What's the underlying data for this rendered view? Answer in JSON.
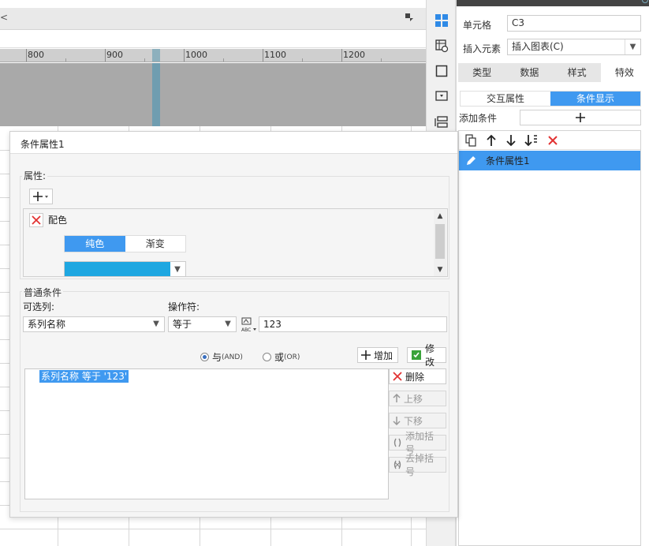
{
  "ruler": {
    "labels": [
      "800",
      "900",
      "1000",
      "1100",
      "1200"
    ]
  },
  "right_panel": {
    "cell_label": "单元格",
    "cell_value": "C3",
    "insert_label": "插入元素",
    "insert_value": "插入图表(C)",
    "tabs": [
      "类型",
      "数据",
      "样式",
      "特效"
    ],
    "active_tab": "特效",
    "subtabs": [
      "交互属性",
      "条件显示"
    ],
    "active_subtab": "条件显示",
    "add_condition_label": "添加条件",
    "condition_items": [
      "条件属性1"
    ]
  },
  "dialog": {
    "title": "条件属性1",
    "properties_label": "属性:",
    "property_name": "配色",
    "color_modes": [
      "纯色",
      "渐变"
    ],
    "active_color_mode": "纯色",
    "color_value": "#1ea7e1",
    "normal_conditions_label": "普通条件",
    "column_label": "可选列:",
    "column_value": "系列名称",
    "operator_label": "操作符:",
    "operator_value": "等于",
    "value_input": "123",
    "radio_and": "与",
    "radio_and_tag": "(AND)",
    "radio_or": "或",
    "radio_or_tag": "(OR)",
    "add_button": "增加",
    "modify_button": "修改",
    "delete_button": "删除",
    "move_up_button": "上移",
    "move_down_button": "下移",
    "add_bracket_button": "添加括号",
    "remove_bracket_button": "去掉括号",
    "condition_text": "系列名称 等于 '123'"
  }
}
